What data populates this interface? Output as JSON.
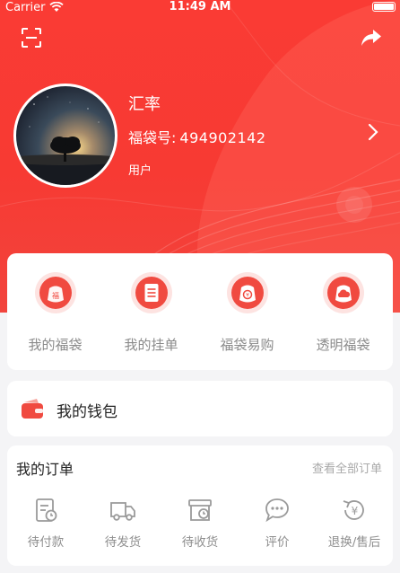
{
  "status_bar": {
    "carrier": "Carrier",
    "time": "11:49 AM"
  },
  "header": {
    "scan_icon": "scan-icon",
    "share_icon": "share-icon"
  },
  "profile": {
    "name": "汇率",
    "bag_no_label": "福袋号:",
    "bag_no_value": "494902142",
    "role": "用户"
  },
  "features": [
    {
      "label": "我的福袋",
      "icon": "bag-icon"
    },
    {
      "label": "我的挂单",
      "icon": "order-list-icon"
    },
    {
      "label": "福袋易购",
      "icon": "trade-icon"
    },
    {
      "label": "透明福袋",
      "icon": "cloud-bag-icon"
    }
  ],
  "wallet": {
    "label": "我的钱包",
    "icon": "wallet-icon"
  },
  "orders": {
    "title": "我的订单",
    "view_all": "查看全部订单",
    "items": [
      {
        "label": "待付款",
        "icon": "pending-payment-icon"
      },
      {
        "label": "待发货",
        "icon": "truck-icon"
      },
      {
        "label": "待收货",
        "icon": "box-icon"
      },
      {
        "label": "评价",
        "icon": "comment-icon"
      },
      {
        "label": "退换/售后",
        "icon": "refund-icon"
      }
    ]
  },
  "colors": {
    "brand_red": "#f73a33",
    "icon_red": "#f04a40",
    "gray_text": "#8a8a8a"
  }
}
